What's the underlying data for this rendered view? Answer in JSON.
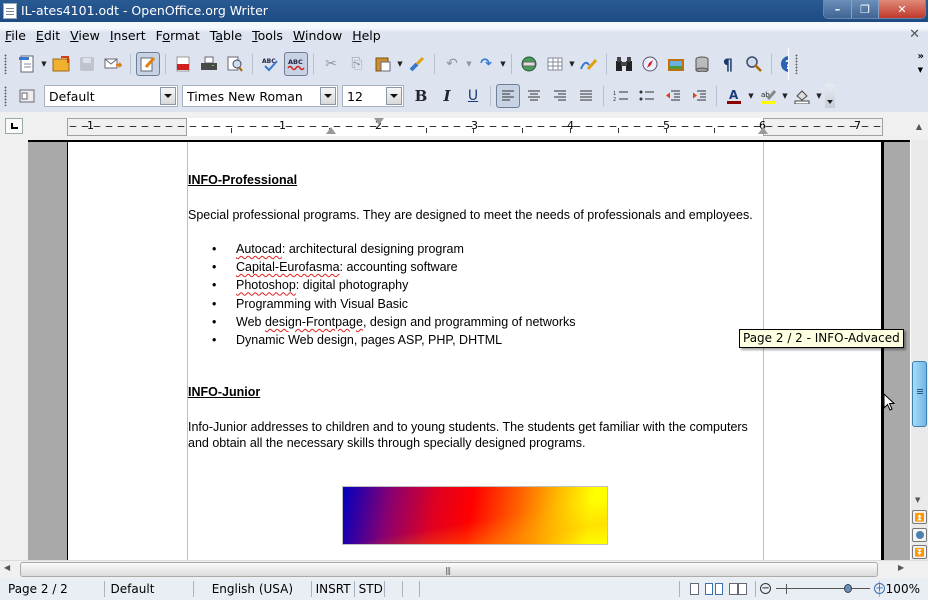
{
  "window": {
    "title": "IL-ates4101.odt - OpenOffice.org Writer",
    "controls": {
      "minimize": "–",
      "maximize": "❐",
      "close": "✕"
    }
  },
  "menubar": {
    "items": [
      {
        "label": "File",
        "mnemonic": "F"
      },
      {
        "label": "Edit",
        "mnemonic": "E"
      },
      {
        "label": "View",
        "mnemonic": "V"
      },
      {
        "label": "Insert",
        "mnemonic": "I"
      },
      {
        "label": "Format",
        "mnemonic": "o"
      },
      {
        "label": "Table",
        "mnemonic": "a"
      },
      {
        "label": "Tools",
        "mnemonic": "T"
      },
      {
        "label": "Window",
        "mnemonic": "W"
      },
      {
        "label": "Help",
        "mnemonic": "H"
      }
    ],
    "close_doc": "✕"
  },
  "standard_toolbar": {
    "buttons": [
      {
        "name": "new",
        "icon": "🗋"
      },
      {
        "name": "open",
        "icon": "📂"
      },
      {
        "name": "save",
        "icon": "💾"
      },
      {
        "name": "email",
        "icon": "✉"
      },
      {
        "name": "edit-file",
        "icon": "📝"
      },
      {
        "name": "export-pdf",
        "icon": "PDF"
      },
      {
        "name": "print",
        "icon": "🖶"
      },
      {
        "name": "page-preview",
        "icon": "🔍"
      },
      {
        "name": "spellcheck",
        "icon": "ABC✓"
      },
      {
        "name": "autospellcheck",
        "icon": "ABC"
      },
      {
        "name": "cut",
        "icon": "✂"
      },
      {
        "name": "copy",
        "icon": "⎘"
      },
      {
        "name": "paste",
        "icon": "📋"
      },
      {
        "name": "format-paintbrush",
        "icon": "🖌"
      },
      {
        "name": "undo",
        "icon": "↶"
      },
      {
        "name": "redo",
        "icon": "↷"
      },
      {
        "name": "hyperlink",
        "icon": "🌐"
      },
      {
        "name": "table",
        "icon": "▦"
      },
      {
        "name": "show-draw",
        "icon": "✎"
      },
      {
        "name": "find-replace",
        "icon": "🔭"
      },
      {
        "name": "navigator",
        "icon": "🧭"
      },
      {
        "name": "gallery",
        "icon": "🖼"
      },
      {
        "name": "data-sources",
        "icon": "🛢"
      },
      {
        "name": "formatting-marks",
        "icon": "¶"
      },
      {
        "name": "zoom",
        "icon": "🔍"
      },
      {
        "name": "help",
        "icon": "?"
      }
    ],
    "overflow": "»"
  },
  "formatting_toolbar": {
    "paragraph_style": "Default",
    "font_name": "Times New Roman",
    "font_size": "12",
    "bold": "B",
    "italic": "I",
    "underline": "U",
    "font_color": "#8b0000",
    "highlight_color": "#ffff00"
  },
  "ruler": {
    "labels": [
      "1",
      "1",
      "2",
      "3",
      "4",
      "5",
      "6",
      "7"
    ]
  },
  "document": {
    "sections": [
      {
        "heading": "INFO-Professional",
        "paragraph": "Special professional programs. They are designed to meet the needs of professionals and employees.",
        "bullets": [
          {
            "term": "Autocad",
            "rest": ": architectural designing program",
            "misspelled": true
          },
          {
            "term": "Capital-Eurofasma",
            "rest": ": accounting software",
            "misspelled": true
          },
          {
            "term": "Photoshop",
            "rest": ": digital photography",
            "misspelled": true
          },
          {
            "pre": "Programming with Visual Basic"
          },
          {
            "pre": "Web ",
            "term": "design-Frontpage",
            "rest": ", design and programming of networks",
            "misspelled": true
          },
          {
            "pre": "Dynamic Web design, pages ASP, PHP, DHTML"
          }
        ]
      },
      {
        "heading": "INFO-Junior",
        "paragraph": "Info-Junior addresses to children and to young students. The students get familiar with the computers and obtain all the necessary skills through specially designed programs.",
        "image": {
          "type": "gradient",
          "colors": [
            "#0000c0",
            "#ff0000",
            "#ffff00"
          ]
        }
      }
    ]
  },
  "tooltip": "Page 2 / 2  - INFO-Advaced",
  "statusbar": {
    "page": "Page 2 / 2",
    "page_style": "Default",
    "language": "English (USA)",
    "insert_mode": "INSRT",
    "selection_mode": "STD",
    "zoom_percent": "100%",
    "zoom_level": 100
  },
  "scroll": {
    "vertical_position": 0.52
  }
}
